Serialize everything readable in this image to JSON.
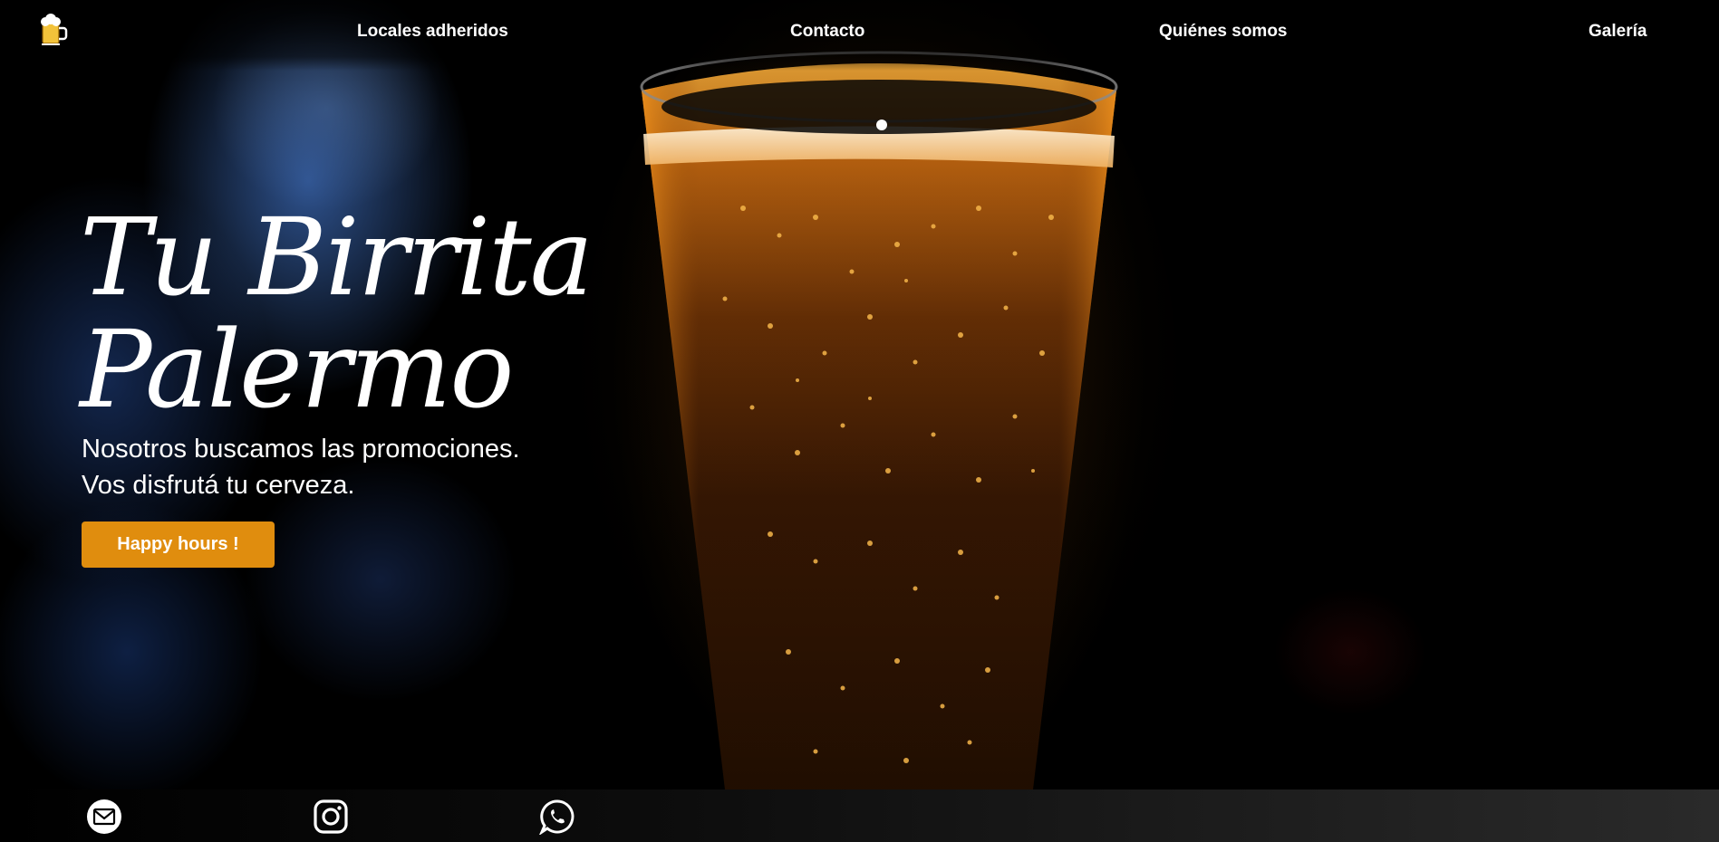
{
  "nav": {
    "logo_icon": "beer-mug-icon",
    "links": [
      {
        "label": "Locales adheridos"
      },
      {
        "label": "Contacto"
      },
      {
        "label": "Quiénes somos"
      },
      {
        "label": "Galería"
      }
    ]
  },
  "hero": {
    "title_line1": "Tu Birrita",
    "title_line2": "Palermo",
    "subtitle_line1": "Nosotros buscamos las promociones.",
    "subtitle_line2": "Vos disfrutá tu cerveza.",
    "cta_label": "Happy hours !",
    "background_image": "glass-of-beer-photo"
  },
  "footer": {
    "social": [
      {
        "icon": "email-icon"
      },
      {
        "icon": "instagram-icon"
      },
      {
        "icon": "whatsapp-icon"
      }
    ]
  },
  "colors": {
    "accent": "#e08d0e",
    "text": "#ffffff",
    "background": "#000000",
    "beer": "#e89a2a"
  }
}
